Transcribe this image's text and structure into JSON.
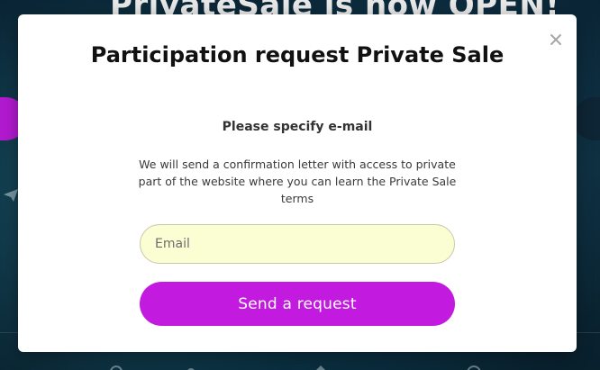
{
  "background": {
    "headline": "PrivateSale is now OPEN!"
  },
  "modal": {
    "title": "Participation request Private Sale",
    "subtitle": "Please specify e-mail",
    "description": "We will send a confirmation letter with access to private part of the website where you can learn the Private Sale terms",
    "email_placeholder": "Email",
    "email_value": "",
    "submit_label": "Send a request",
    "close_icon": "close-icon"
  },
  "colors": {
    "accent": "#c31ae0",
    "input_bg": "#fbfdd3",
    "page_bg": "#0b2332"
  }
}
